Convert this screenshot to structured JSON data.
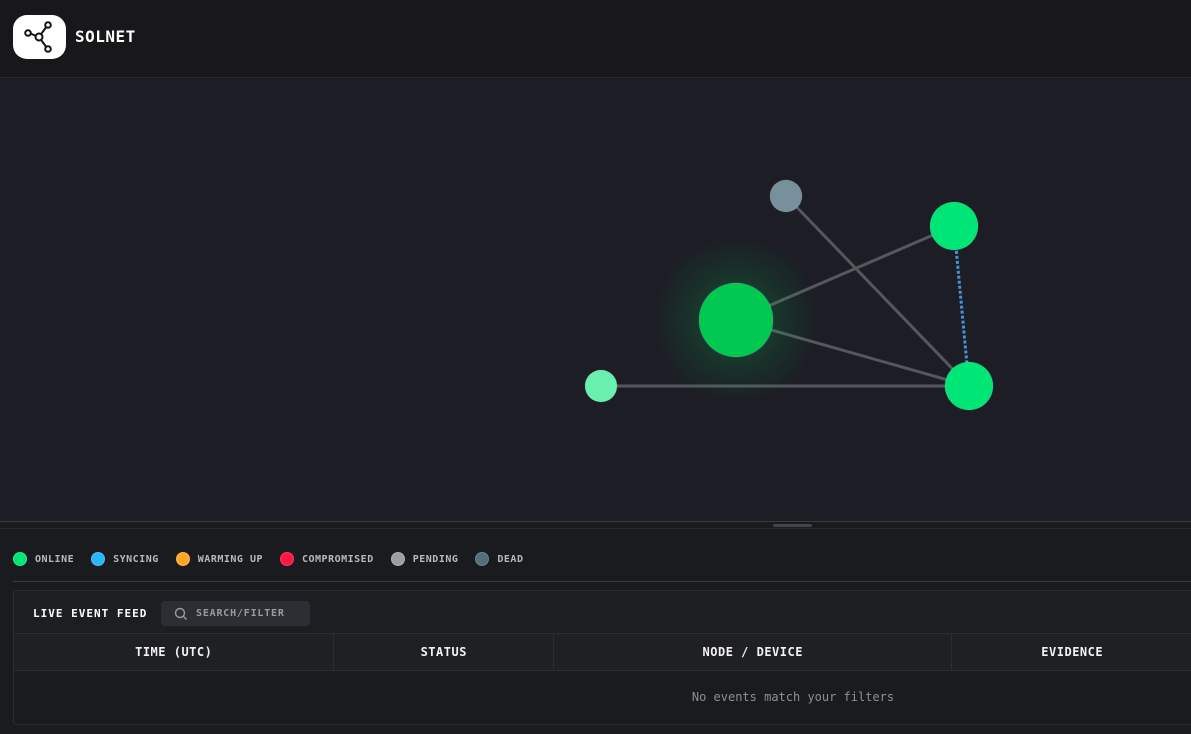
{
  "app": {
    "title": "SOLNET",
    "logo_icon": "network-graph-icon"
  },
  "graph": {
    "nodes": [
      {
        "id": "hub",
        "status": "online",
        "color": "#00c853",
        "glow": true
      },
      {
        "id": "top-right",
        "status": "online",
        "color": "#00e676"
      },
      {
        "id": "bottom-right",
        "status": "online",
        "color": "#00e676"
      },
      {
        "id": "left",
        "status": "online",
        "color": "#69f0ae"
      },
      {
        "id": "top",
        "status": "dead",
        "color": "#78909c"
      }
    ],
    "edges": [
      {
        "from": "hub",
        "to": "top-right",
        "style": "solid"
      },
      {
        "from": "hub",
        "to": "bottom-right",
        "style": "solid"
      },
      {
        "from": "top",
        "to": "bottom-right",
        "style": "solid"
      },
      {
        "from": "left",
        "to": "bottom-right",
        "style": "solid"
      },
      {
        "from": "top-right",
        "to": "bottom-right",
        "style": "dashed",
        "color": "#4a90d9"
      }
    ]
  },
  "legend": [
    {
      "label": "ONLINE",
      "color": "#00e676"
    },
    {
      "label": "SYNCING",
      "color": "#29b6f6"
    },
    {
      "label": "WARMING UP",
      "color": "#ffa726"
    },
    {
      "label": "COMPROMISED",
      "color": "#ff1744"
    },
    {
      "label": "PENDING",
      "color": "#9e9e9e"
    },
    {
      "label": "DEAD",
      "color": "#546e7a"
    }
  ],
  "feed": {
    "title": "LIVE EVENT FEED",
    "search_placeholder": "SEARCH/FILTER",
    "search_icon": "search-icon",
    "columns": [
      "TIME (UTC)",
      "STATUS",
      "NODE / DEVICE",
      "EVIDENCE"
    ],
    "empty_message": "No events match your filters"
  }
}
